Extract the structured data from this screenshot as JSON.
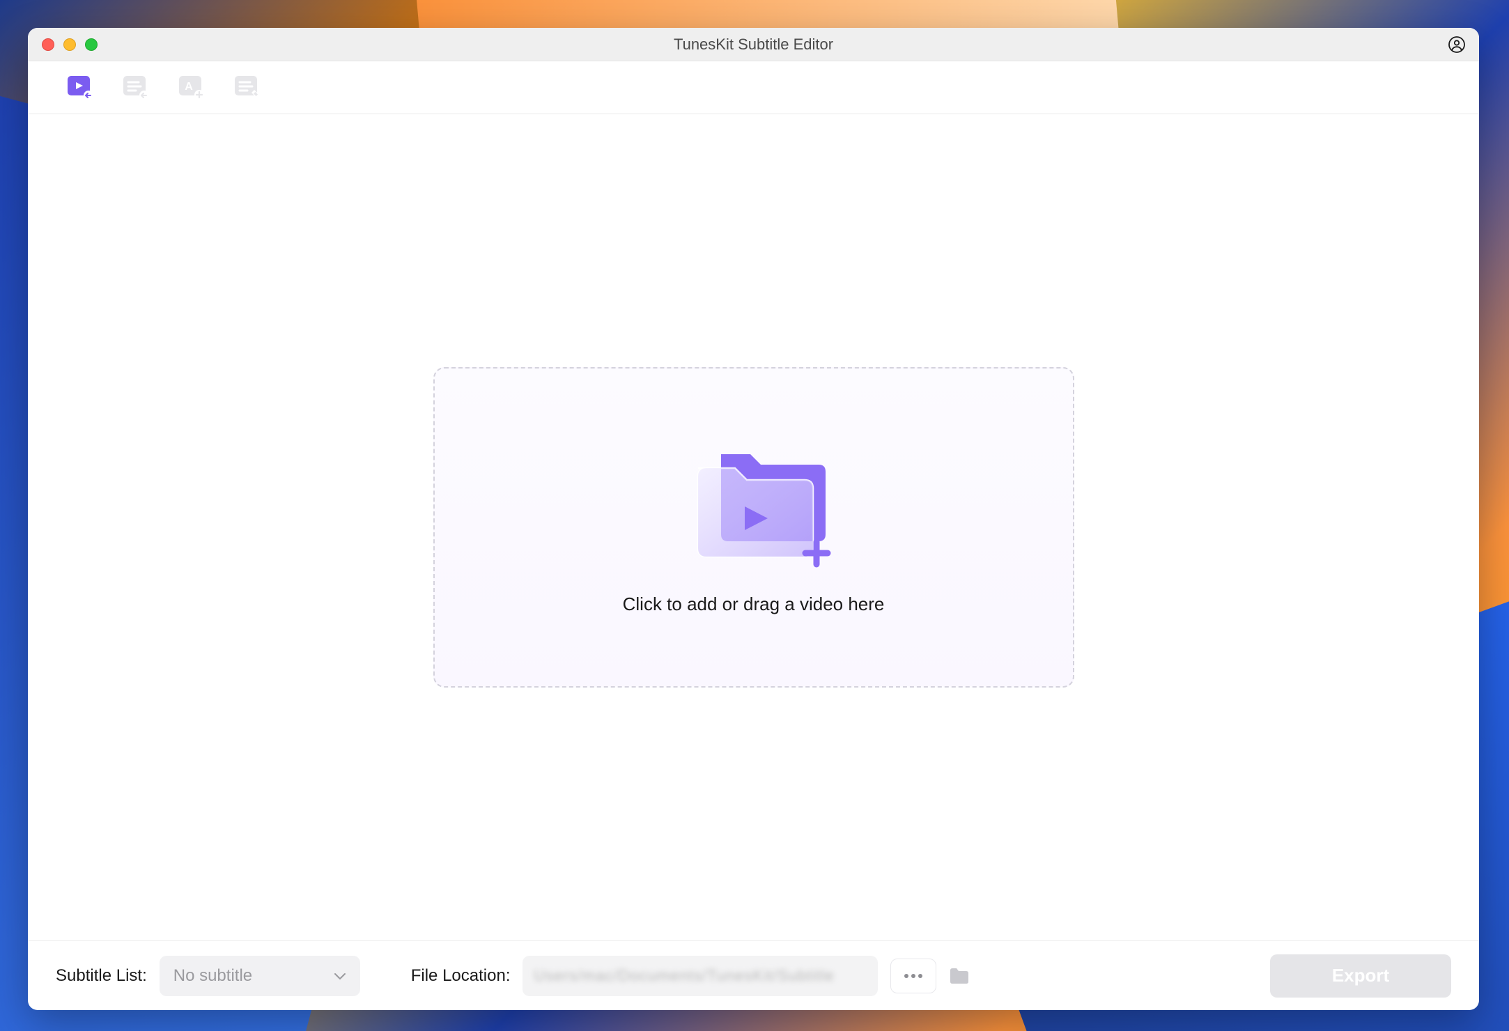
{
  "window": {
    "title": "TunesKit Subtitle Editor"
  },
  "toolbar": {
    "icons": [
      "import-video",
      "import-subtitle",
      "subtitle-style",
      "edit-subtitle"
    ]
  },
  "dropzone": {
    "text": "Click to add or drag a video here"
  },
  "bottombar": {
    "subtitle_label": "Subtitle List:",
    "subtitle_value": "No subtitle",
    "file_location_label": "File Location:",
    "file_location_value": "Users/mac/Documents/TunesKit/Subtitle",
    "export_label": "Export"
  },
  "colors": {
    "accent": "#7b5cf0",
    "disabled": "#e5e5e8"
  }
}
